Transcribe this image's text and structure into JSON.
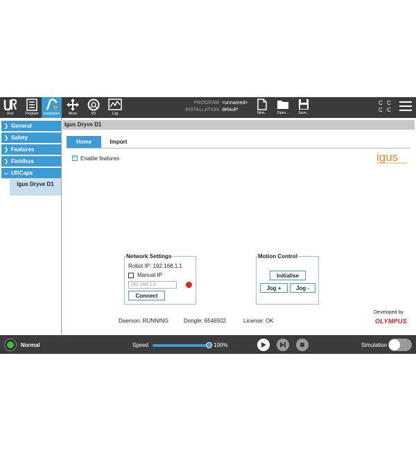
{
  "topbar": {
    "buttons": [
      {
        "label": "Run",
        "icon": "ur-logo-icon"
      },
      {
        "label": "Program",
        "icon": "program-icon"
      },
      {
        "label": "Installation",
        "icon": "installation-icon"
      },
      {
        "label": "Move",
        "icon": "move-icon"
      },
      {
        "label": "I/O",
        "icon": "io-icon"
      },
      {
        "label": "Log",
        "icon": "log-icon"
      }
    ],
    "program_key": "PROGRAM",
    "program_value": "<unnamed>",
    "installation_key": "INSTALLATION",
    "installation_value": "default*",
    "file_buttons": [
      {
        "label": "New...",
        "icon": "new-file-icon"
      },
      {
        "label": "Open...",
        "icon": "open-folder-icon"
      },
      {
        "label": "Save...",
        "icon": "save-icon"
      }
    ],
    "cc_text": [
      "C C",
      "C C"
    ]
  },
  "sidebar": {
    "items": [
      {
        "label": "General"
      },
      {
        "label": "Safety"
      },
      {
        "label": "Features"
      },
      {
        "label": "Fieldbus"
      },
      {
        "label": "URCaps"
      }
    ],
    "sub_item": "Igus Dryve D1"
  },
  "main": {
    "title": "Igus Dryve D1",
    "tabs": [
      {
        "label": "Home",
        "active": true
      },
      {
        "label": "Import",
        "active": false
      }
    ],
    "enable_features_label": "Enable features",
    "logo_text": "igus",
    "network": {
      "title": "Network Settings",
      "robot_ip": "Robot IP: 192.168.1.1",
      "manual_ip_label": "Manual IP",
      "ip_placeholder": "192.168.1.6",
      "connect_label": "Connect",
      "status_color": "#e5231b"
    },
    "motion": {
      "title": "Motion Control",
      "initialise_label": "Initialise",
      "jog_plus_label": "Jog +",
      "jog_minus_label": "Jog -"
    },
    "status": {
      "daemon": "Daemon: RUNNING",
      "dongle": "Dongle: 6546502",
      "license": "License: OK"
    },
    "developed_by": "Developed by",
    "developer_logo": "OLYMPUS"
  },
  "bottombar": {
    "mode": "Normal",
    "speed_label": "Speed",
    "speed_value": "100%",
    "speed_fraction": 1.0,
    "simulation_label": "Simulation",
    "simulation_on": false
  },
  "colors": {
    "accent": "#3a9bd5",
    "bar": "#3b3b3b",
    "status_red": "#e5231b",
    "power_green": "#3dbb3d"
  }
}
